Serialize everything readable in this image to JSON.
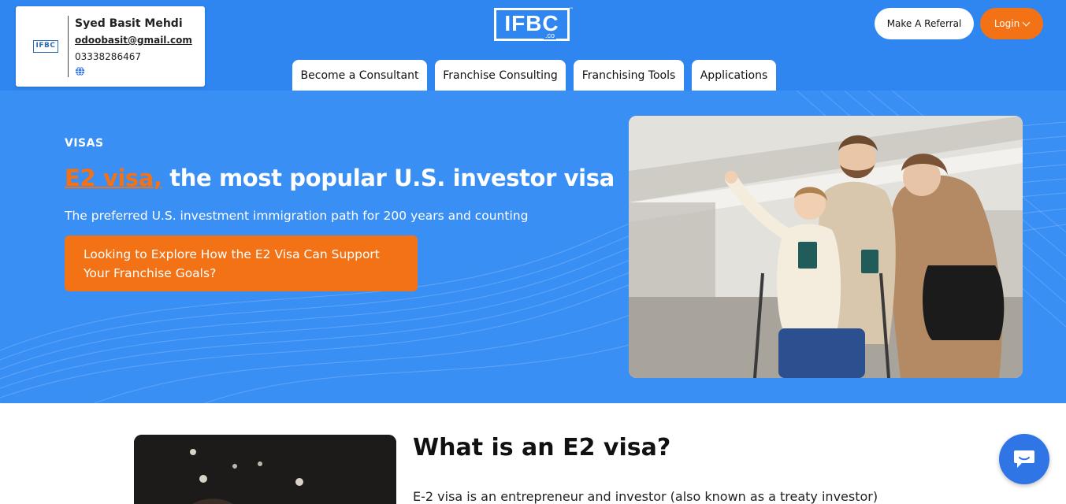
{
  "contact_card": {
    "logo_text": "IFBC",
    "name": "Syed Basit Mehdi",
    "email": "odoobasit@gmail.com",
    "phone": "03338286467"
  },
  "brand": {
    "logo_text": "IFBC",
    "logo_suffix": ".co",
    "trademark": "™"
  },
  "header_actions": {
    "referral_label": "Make A Referral",
    "login_label": "Login"
  },
  "nav": {
    "tabs": [
      {
        "label": "Become a Consultant"
      },
      {
        "label": "Franchise Consulting"
      },
      {
        "label": "Franchising Tools"
      },
      {
        "label": "Applications"
      }
    ]
  },
  "hero": {
    "eyebrow": "VISAS",
    "headline_accent": "E2 visa,",
    "headline_rest": " the most popular U.S. investor visa",
    "subheadline": "The preferred U.S. investment immigration path for 200 years and counting",
    "cta_label": "Looking to Explore How the E2 Visa Can Support Your Franchise Goals?"
  },
  "content": {
    "section_title": "What is an E2 visa?",
    "section_body": "E-2 visa is an entrepreneur and investor (also known as a treaty investor)"
  },
  "icons": {
    "globe": "globe-icon",
    "chevron": "chevron-down-icon",
    "chat": "chat-bubble-icon"
  },
  "colors": {
    "header_blue": "#2f86f0",
    "hero_blue": "#3a8ff5",
    "accent_orange": "#f47216",
    "chat_blue": "#2f75e6"
  }
}
